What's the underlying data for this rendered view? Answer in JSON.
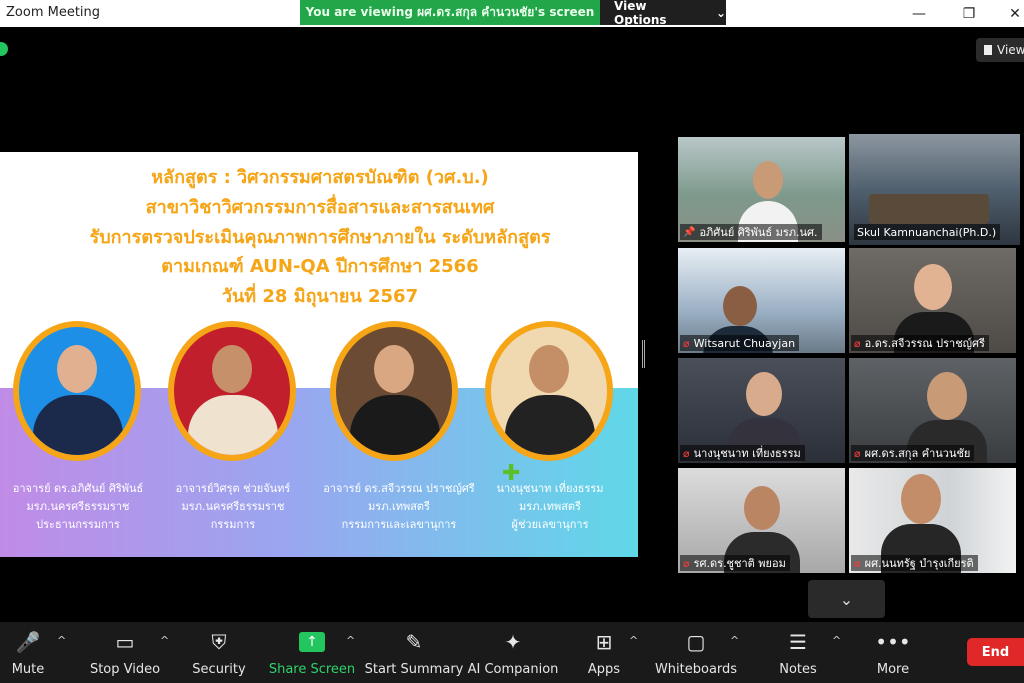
{
  "window": {
    "title": "Zoom Meeting",
    "minimize": "—",
    "maximize": "❐",
    "close": "✕"
  },
  "banner": {
    "viewing_text": "You are viewing ผศ.ดร.สกุล คำนวนชัย's screen",
    "options_label": "View Options",
    "options_caret": "⌄"
  },
  "view_button": {
    "label": "View"
  },
  "slide": {
    "lines": [
      "หลักสูตร : วิศวกรรมศาสตรบัณฑิต (วศ.บ.)",
      "สาขาวิชาวิศวกรรมการสื่อสารและสารสนเทศ",
      "รับการตรวจประเมินคุณภาพการศึกษาภายใน ระดับหลักสูตร",
      "ตามเกณฑ์ AUN-QA ปีการศึกษา 2566",
      "วันที่ 28 มิถุนายน 2567"
    ],
    "people": [
      {
        "line1": "อาจารย์ ดร.อภิศันย์ ศิริพันธ์",
        "line2": "มรภ.นครศรีธรรมราช",
        "line3": "ประธานกรรมการ"
      },
      {
        "line1": "อาจารย์วิศรุต ช่วยจันทร์",
        "line2": "มรภ.นครศรีธรรมราช",
        "line3": "กรรมการ"
      },
      {
        "line1": "อาจารย์ ดร.สจีวรรณ ปราชญ์ศรี",
        "line2": "มรภ.เทพสตรี",
        "line3": "กรรมการและเลขานุการ"
      },
      {
        "line1": "นางนุชนาท เที่ยงธรรม",
        "line2": "มรภ.เทพสตรี",
        "line3": "ผู้ช่วยเลขานุการ"
      }
    ]
  },
  "participants": [
    {
      "name": "อภิศันย์ ศิริพันธ์ มรภ.นศ.",
      "pinned": true,
      "muted": false
    },
    {
      "name": "Skul Kamnuanchai(Ph.D.)",
      "pinned": false,
      "muted": false,
      "active": true
    },
    {
      "name": "Witsarut Chuayjan",
      "pinned": false,
      "muted": true
    },
    {
      "name": "อ.ดร.สจีวรรณ ปราชญ์ศรี",
      "pinned": false,
      "muted": true
    },
    {
      "name": "นางนุชนาท เที่ยงธรรม",
      "pinned": false,
      "muted": true
    },
    {
      "name": "ผศ.ดร.สกุล คำนวนชัย",
      "pinned": false,
      "muted": true
    },
    {
      "name": "รศ.ดร.ชูชาติ พยอม",
      "pinned": false,
      "muted": true
    },
    {
      "name": "ผศ.นนทรัฐ บำรุงเกียรติ",
      "pinned": false,
      "muted": true
    }
  ],
  "gallery": {
    "scroll_down": "⌄"
  },
  "toolbar": {
    "items": [
      {
        "label": "Mute",
        "icon": "🎤"
      },
      {
        "label": "Stop Video",
        "icon": "▭"
      },
      {
        "label": "Security",
        "icon": "⛨"
      },
      {
        "label": "Share Screen",
        "icon": "↑"
      },
      {
        "label": "Start Summary",
        "icon": "✎"
      },
      {
        "label": "AI Companion",
        "icon": "✦"
      },
      {
        "label": "Apps",
        "icon": "⊞"
      },
      {
        "label": "Whiteboards",
        "icon": "▢"
      },
      {
        "label": "Notes",
        "icon": "☰"
      },
      {
        "label": "More",
        "icon": "•••"
      }
    ],
    "caret": "^",
    "end_label": "End"
  },
  "colors": {
    "accent_green": "#22c55e",
    "end_red": "#e02828",
    "slide_title_orange": "#f5a516"
  }
}
